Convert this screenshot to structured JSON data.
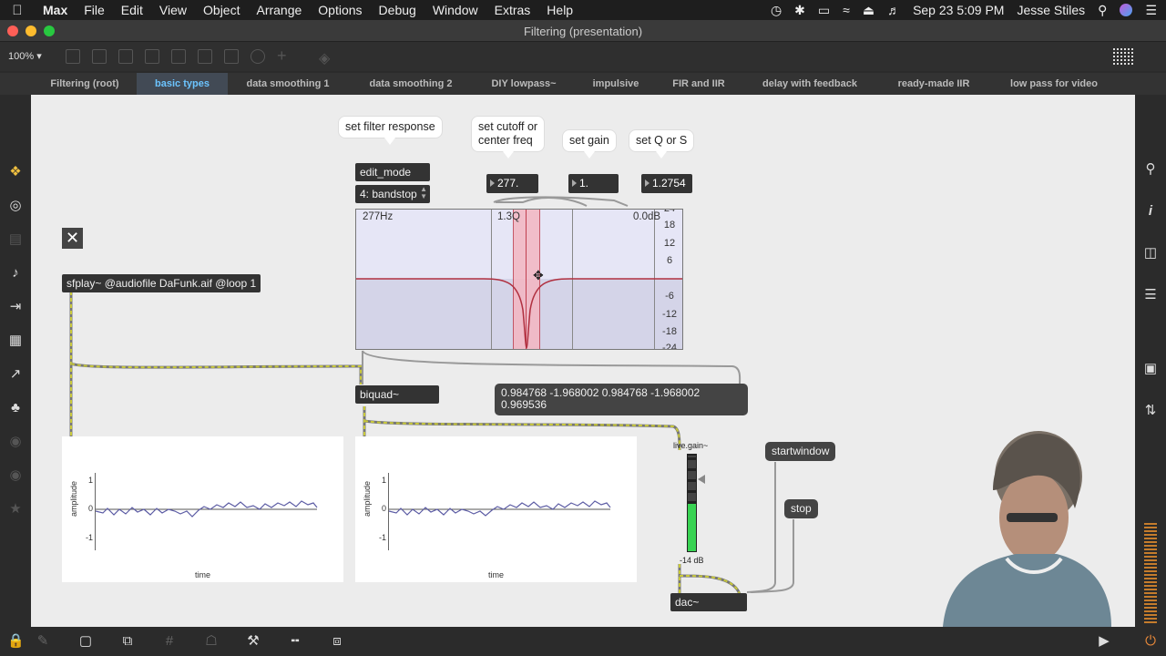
{
  "menubar": {
    "app": "Max",
    "items": [
      "File",
      "Edit",
      "View",
      "Object",
      "Arrange",
      "Options",
      "Debug",
      "Window",
      "Extras",
      "Help"
    ],
    "datetime": "Sep 23  5:09 PM",
    "user": "Jesse Stiles"
  },
  "window": {
    "title": "Filtering (presentation)"
  },
  "toolbar": {
    "zoom": "100%"
  },
  "tabs": [
    {
      "label": "Filtering (root)"
    },
    {
      "label": "basic types"
    },
    {
      "label": "data smoothing 1"
    },
    {
      "label": "data smoothing 2"
    },
    {
      "label": "DIY lowpass~"
    },
    {
      "label": "impulsive"
    },
    {
      "label": "FIR and IIR"
    },
    {
      "label": "delay with feedback"
    },
    {
      "label": "ready-made IIR"
    },
    {
      "label": "low pass for video"
    }
  ],
  "patch": {
    "bubbles": {
      "filter_response": "set filter response",
      "cutoff_line1": "set cutoff or",
      "cutoff_line2": "center freq",
      "gain": "set gain",
      "q": "set Q or S"
    },
    "edit_mode": "edit_mode",
    "filter_type": "4: bandstop",
    "numbers": {
      "freq": "277.",
      "gain": "1.",
      "q": "1.2754"
    },
    "filtergraph": {
      "freq_label": "277Hz",
      "q_label": "1.3Q",
      "gain_label": "0.0dB",
      "ticks": [
        "24",
        "18",
        "12",
        "6",
        "-6",
        "-12",
        "-18",
        "-24"
      ]
    },
    "sfplay": "sfplay~ @audiofile DaFunk.aif @loop 1",
    "biquad": "biquad~",
    "coeffs_line1": "0.984768 -1.968002 0.984768 -1.968002",
    "coeffs_line2": "0.969536",
    "plot_left": {
      "ylabel": "amplitude",
      "xlabel": "time",
      "ticks": [
        "1",
        "0",
        "-1"
      ]
    },
    "plot_right": {
      "ylabel": "amplitude",
      "xlabel": "time",
      "ticks": [
        "1",
        "0",
        "-1"
      ]
    },
    "live_gain": {
      "name": "live.gain~",
      "value": "-14 dB"
    },
    "startwindow": "startwindow",
    "stop": "stop",
    "dac": "dac~"
  },
  "colors": {
    "active_tab_text": "#6cc4ff",
    "filter_curve": "#b03040",
    "band_highlight": "#f4b6c2",
    "meter_green": "#39d353",
    "patch_cord_signal": "#c8c83a"
  }
}
